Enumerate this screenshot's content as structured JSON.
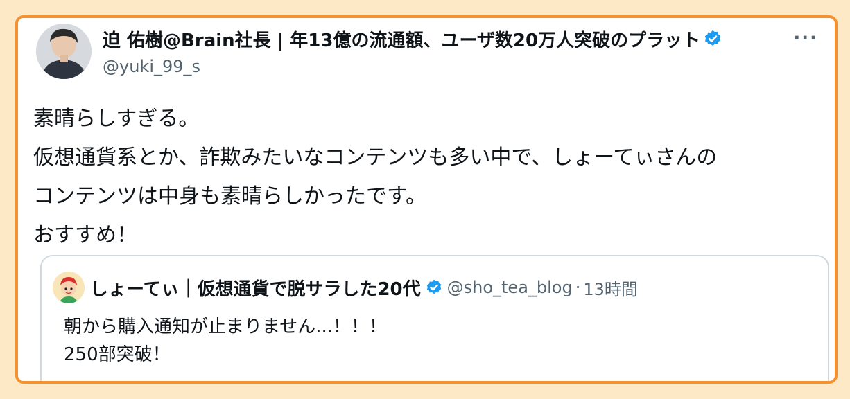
{
  "tweet": {
    "author_name": "迫 佑樹@Brain社長 | 年13億の流通額、ユーザ数20万人突破のプラット",
    "author_handle": "@yuki_99_s",
    "more_label": "···",
    "body_lines": [
      "素晴らしすぎる。",
      "仮想通貨系とか、詐欺みたいなコンテンツも多い中で、しょーてぃさんの",
      "コンテンツは中身も素晴らしかったです。",
      "おすすめ！"
    ]
  },
  "quoted_tweet": {
    "author_name": "しょーてぃ｜仮想通貨で脱サラした20代",
    "author_handle": "@sho_tea_blog",
    "separator": "·",
    "time": "13時間",
    "body_lines": [
      "朝から購入通知が止まりません...！！！",
      "250部突破！"
    ]
  },
  "colors": {
    "background": "#fde9c6",
    "frame_border": "#f5922e",
    "verified_badge": "#1d9bf0",
    "secondary_text": "#536471"
  },
  "icons": {
    "verified": "verified-badge-icon",
    "more": "more-options-icon"
  }
}
